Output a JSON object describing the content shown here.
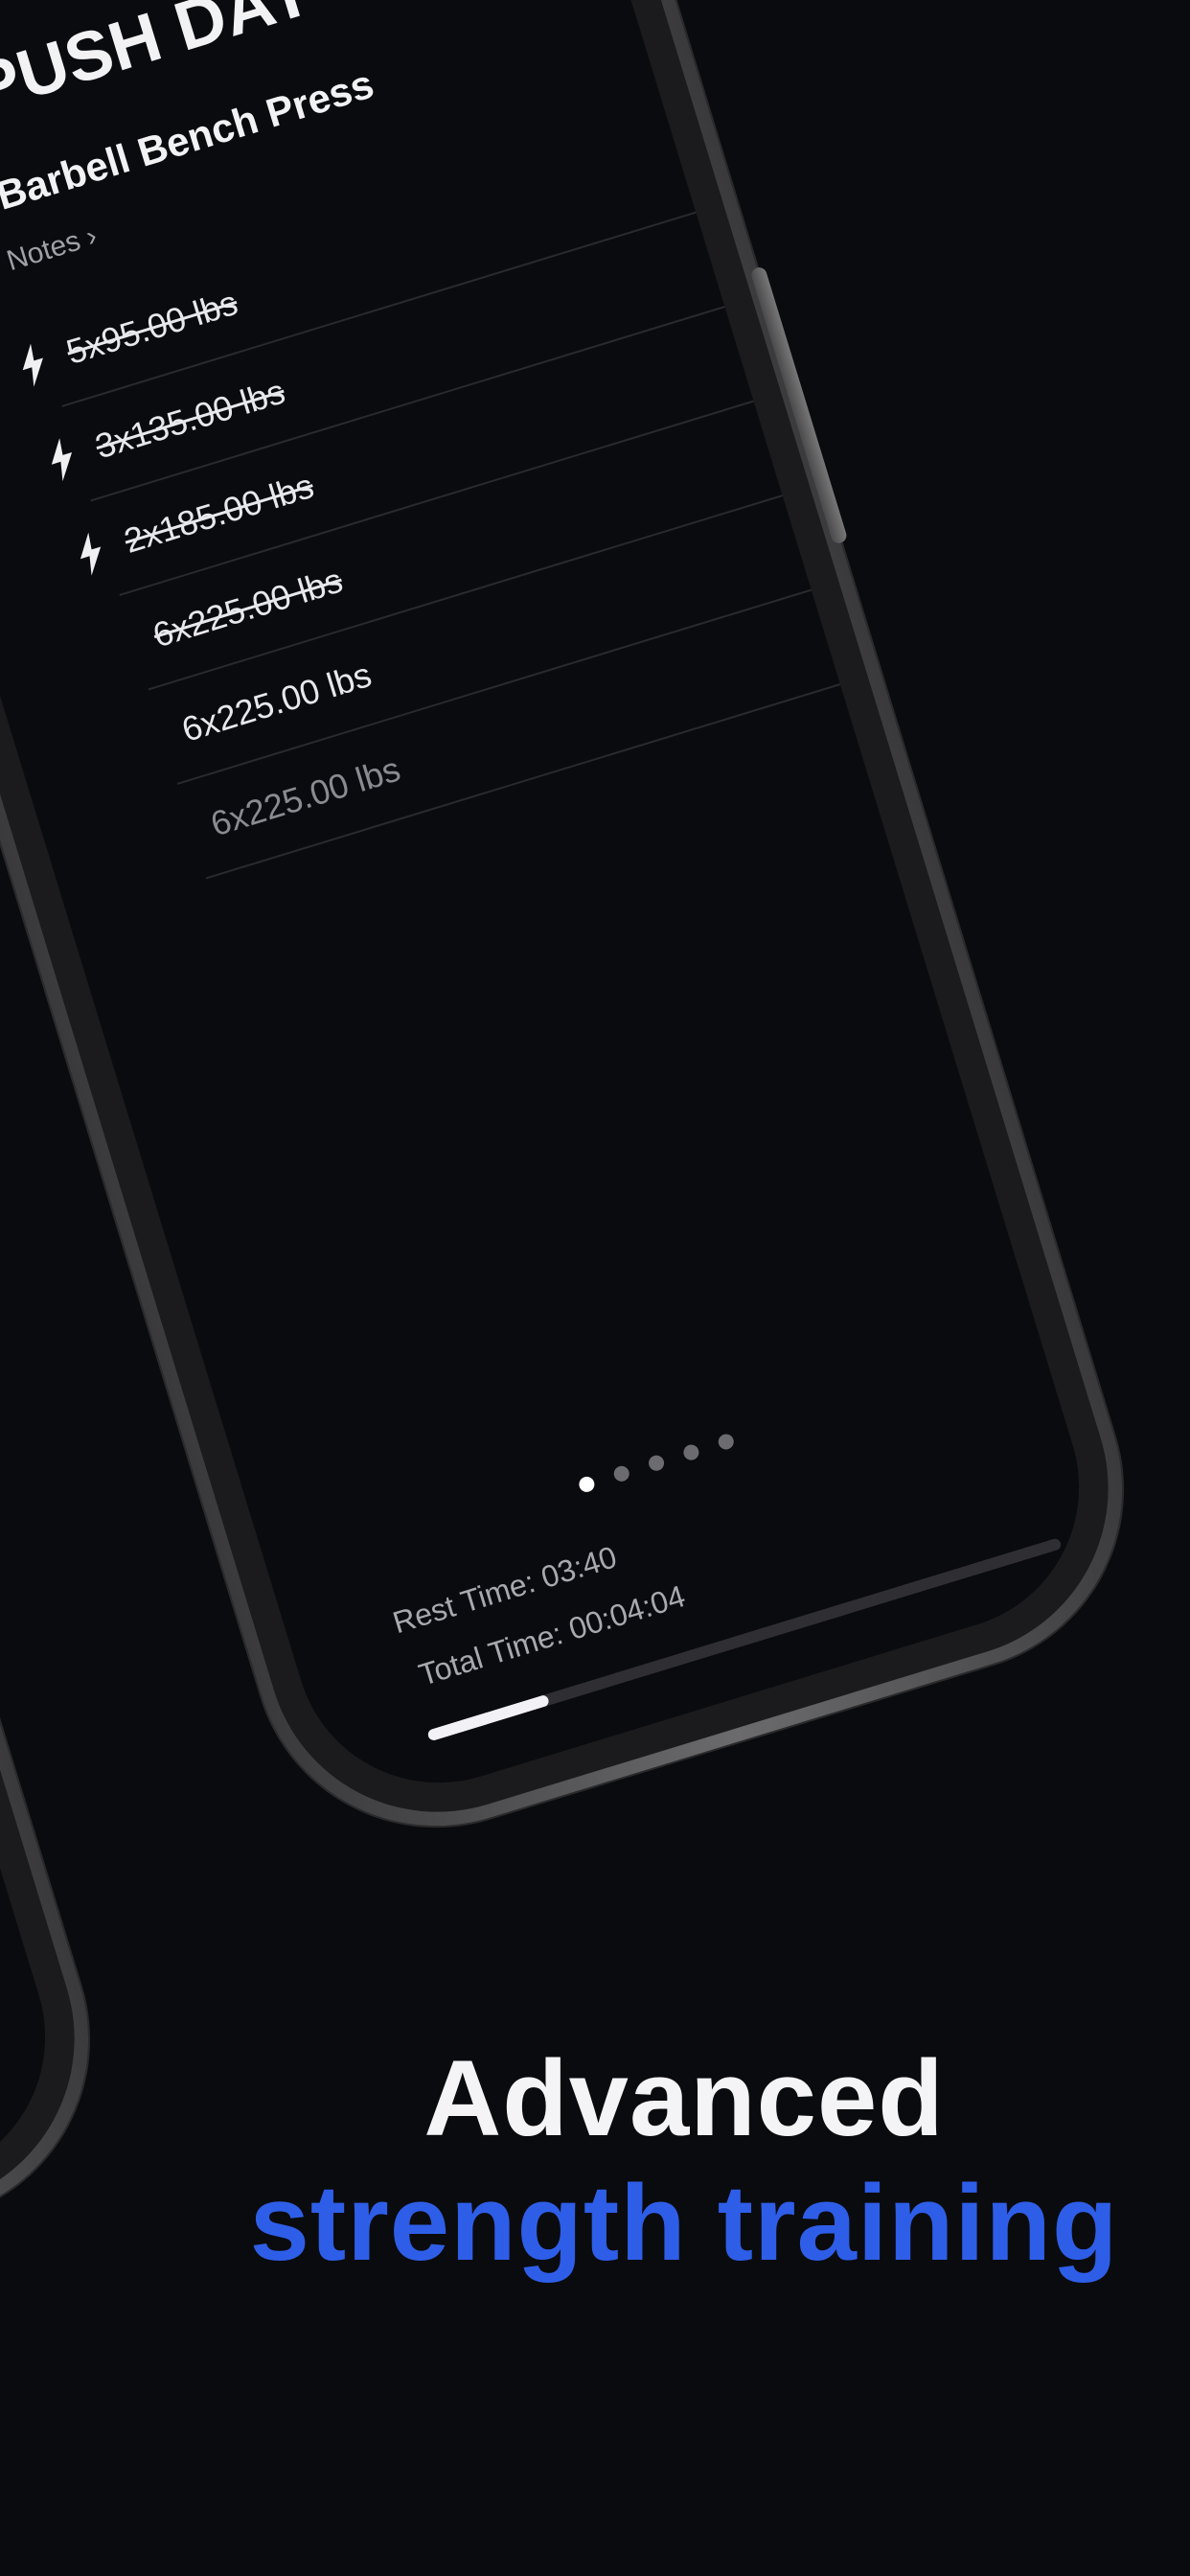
{
  "workout": {
    "title": "PUSH DAY",
    "exercise": "Barbell Bench Press",
    "notes_label": "Notes",
    "notes_chevron": "›",
    "sets": [
      {
        "text": "5x95.00 lbs",
        "warmup": true,
        "done": true
      },
      {
        "text": "3x135.00 lbs",
        "warmup": true,
        "done": true
      },
      {
        "text": "2x185.00 lbs",
        "warmup": true,
        "done": true
      },
      {
        "text": "6x225.00 lbs",
        "warmup": false,
        "done": true
      },
      {
        "text": "6x225.00 lbs",
        "warmup": false,
        "done": false,
        "current": true
      },
      {
        "text": "6x225.00 lbs",
        "warmup": false,
        "done": false
      }
    ]
  },
  "pager": {
    "count": 5,
    "active": 0
  },
  "timer": {
    "rest_time": "Rest Time: 03:40",
    "total_time": "Total Time: 00:04:04",
    "progress": 0.19
  },
  "headline": {
    "line1": "Advanced",
    "line2": "strength training"
  },
  "colors": {
    "accent": "#2e5ee8",
    "background": "#0a0b0e"
  }
}
